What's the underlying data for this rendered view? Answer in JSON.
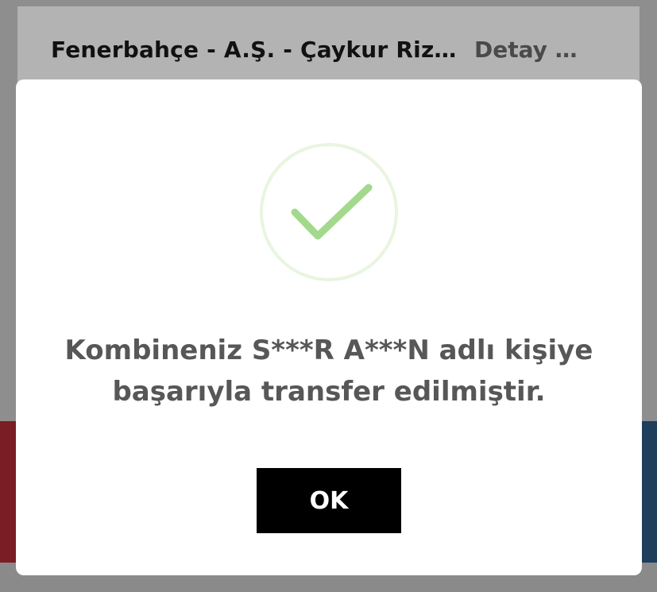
{
  "background": {
    "match_title": "Fenerbahçe - A.Ş. - Çaykur Riz…",
    "detail_link": "Detay G…"
  },
  "dialog": {
    "icon": "check-circle-icon",
    "icon_color": "#9fd68a",
    "message_line_1": "Kombineniz S***R A***N adlı kişiye",
    "message_line_2": "başarıyla transfer edilmiştir.",
    "ok_label": "OK"
  },
  "colors": {
    "overlay": "#8e8e8e",
    "button_bg": "#000000",
    "button_text": "#ffffff",
    "message_text": "#575757",
    "band_left": "#7a1d25",
    "band_right": "#1d3f5c"
  }
}
